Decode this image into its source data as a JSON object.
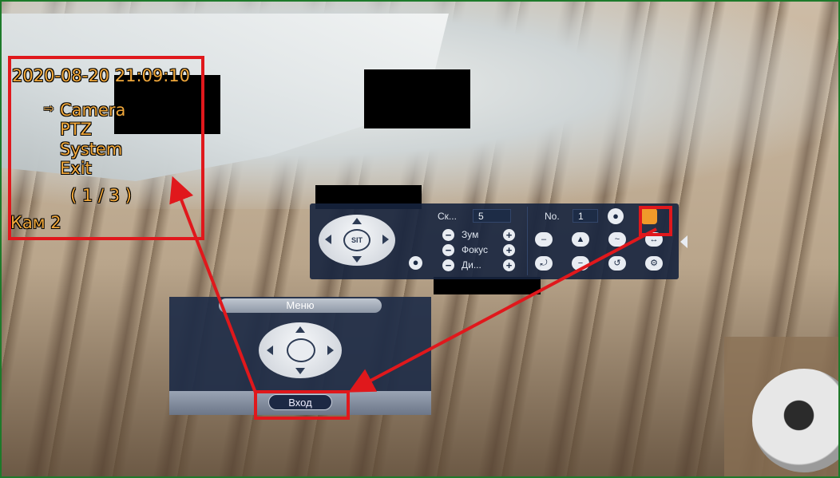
{
  "osd": {
    "datetime": "2020-08-20 21:09:10",
    "menu_pointer": "⇨",
    "menu_items": [
      "Camera",
      "PTZ",
      "System",
      "Exit"
    ],
    "page_indicator": "( 1 / 3 )",
    "channel_name": "Кам 2"
  },
  "ptz_panel": {
    "center_label": "SIT",
    "speed_label": "Ск...",
    "speed_value": "5",
    "zoom_label": "Зум",
    "focus_label": "Фокус",
    "iris_label": "Ди...",
    "preset_label": "No.",
    "preset_value": "1",
    "minus_symbol": "−",
    "plus_symbol": "+"
  },
  "menu_dialog": {
    "title": "Меню",
    "enter_button": "Вход"
  },
  "colors": {
    "osd_text": "#f0a73a",
    "highlight_box": "#e0181c",
    "panel_bg": "#16243e"
  }
}
